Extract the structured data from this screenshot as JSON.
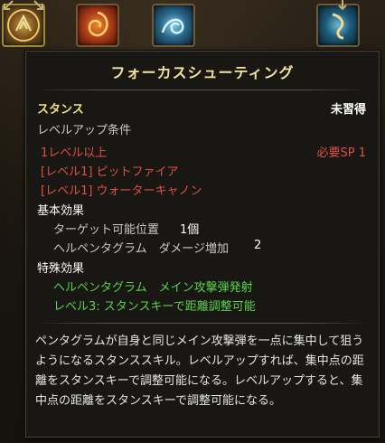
{
  "skill_bar": {
    "icons": [
      "claw-skill-icon",
      "fire-vortex-skill-icon",
      "water-dragon-skill-icon",
      "dragon-skill-icon"
    ]
  },
  "tooltip": {
    "title": "フォーカスシューティング",
    "stance_label": "スタンス",
    "status": "未習得",
    "levelup_cond_label": "レベルアップ条件",
    "req_level": "1レベル以上",
    "req_sp": "必要SP 1",
    "req_skill_1": "[レベル1] ピットファイア",
    "req_skill_2": "[レベル1] ウォーターキャノン",
    "basic_effect_label": "基本効果",
    "target_count_label": "ターゲット可能位置",
    "target_count_value": "1個",
    "pentagram_damage_label": "ヘルペンタグラム　ダメージ増加",
    "pentagram_damage_value": "2",
    "special_effect_label": "特殊効果",
    "special_1": "ヘルペンタグラム　メイン攻撃弾発射",
    "special_2": "レベル3: スタンスキーで距離調整可能",
    "description": "ペンタグラムが自身と同じメイン攻撃弾を一点に集中して狙うようになるスタンススキル。レベルアップすれば、集中点の距離をスタンスキーで調整可能になる。レベルアップすると、集中点の距離をスタンスキーで調整可能になる。"
  }
}
